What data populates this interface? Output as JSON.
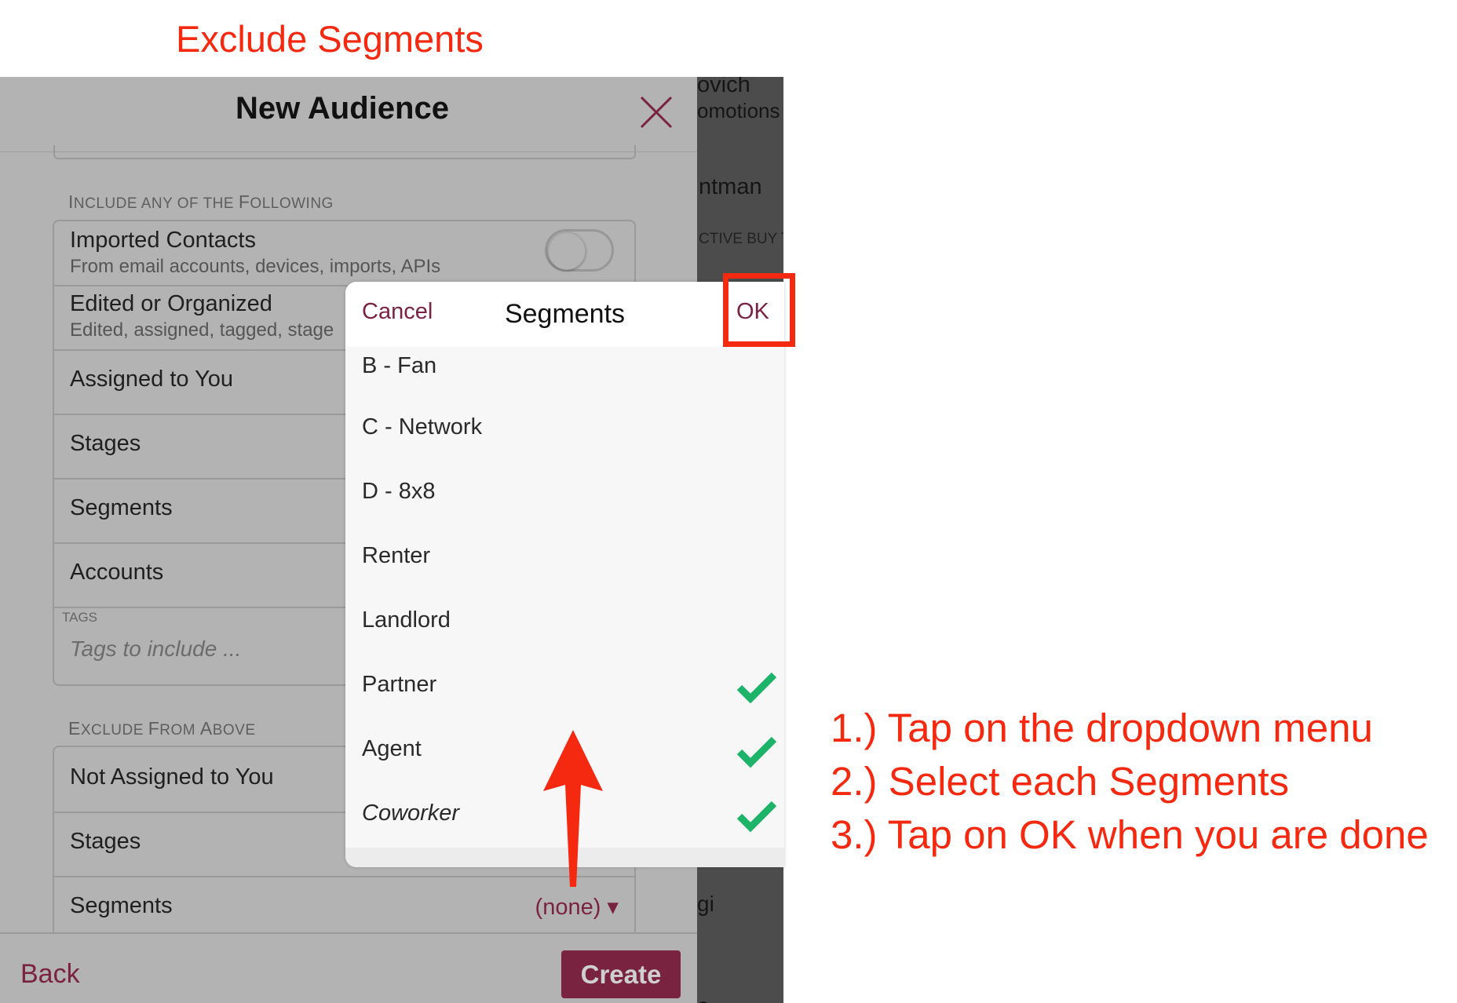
{
  "annotation": {
    "title": "Exclude Segments",
    "steps": [
      "1.) Tap on the dropdown menu",
      "2.) Select each Segments",
      "3.) Tap on OK when you are done"
    ],
    "highlight_color": "#f5290f"
  },
  "background_app": {
    "lines": [
      "ovich",
      "omotions a",
      "ntman",
      "CTIVE BUY T",
      "gi",
      "a"
    ]
  },
  "modal": {
    "title": "New Audience",
    "close_icon": "close-x-icon",
    "include_section": {
      "label_first": "I",
      "label_rest": "NCLUDE ANY OF THE ",
      "label_first2": "F",
      "label_rest2": "OLLOWING",
      "rows": [
        {
          "label": "Imported Contacts",
          "sub": "From email accounts, devices, imports, APIs",
          "toggle": false
        },
        {
          "label": "Edited or Organized",
          "sub": "Edited, assigned, tagged, stage"
        },
        {
          "label": "Assigned to You"
        },
        {
          "label": "Stages"
        },
        {
          "label": "Segments"
        },
        {
          "label": "Accounts"
        }
      ],
      "tags_caption": "TAGS",
      "tags_placeholder": "Tags to include ..."
    },
    "exclude_section": {
      "label_first": "E",
      "label_rest": "XCLUDE ",
      "label_first2": "F",
      "label_rest2": "ROM ",
      "label_first3": "A",
      "label_rest3": "BOVE",
      "rows": [
        {
          "label": "Not Assigned to You"
        },
        {
          "label": "Stages"
        },
        {
          "label": "Segments",
          "value": "(none) ▾"
        }
      ]
    },
    "footer": {
      "back_label": "Back",
      "create_label": "Create"
    },
    "brand_color": "#7a2340"
  },
  "popup": {
    "cancel_label": "Cancel",
    "title": "Segments",
    "ok_label": "OK",
    "options": [
      {
        "label": "B - Fan",
        "checked": false
      },
      {
        "label": "C - Network",
        "checked": false
      },
      {
        "label": "D - 8x8",
        "checked": false
      },
      {
        "label": "Renter",
        "checked": false
      },
      {
        "label": "Landlord",
        "checked": false
      },
      {
        "label": "Partner",
        "checked": true
      },
      {
        "label": "Agent",
        "checked": true
      },
      {
        "label": "Coworker",
        "checked": true
      }
    ],
    "check_color": "#1db46a"
  }
}
